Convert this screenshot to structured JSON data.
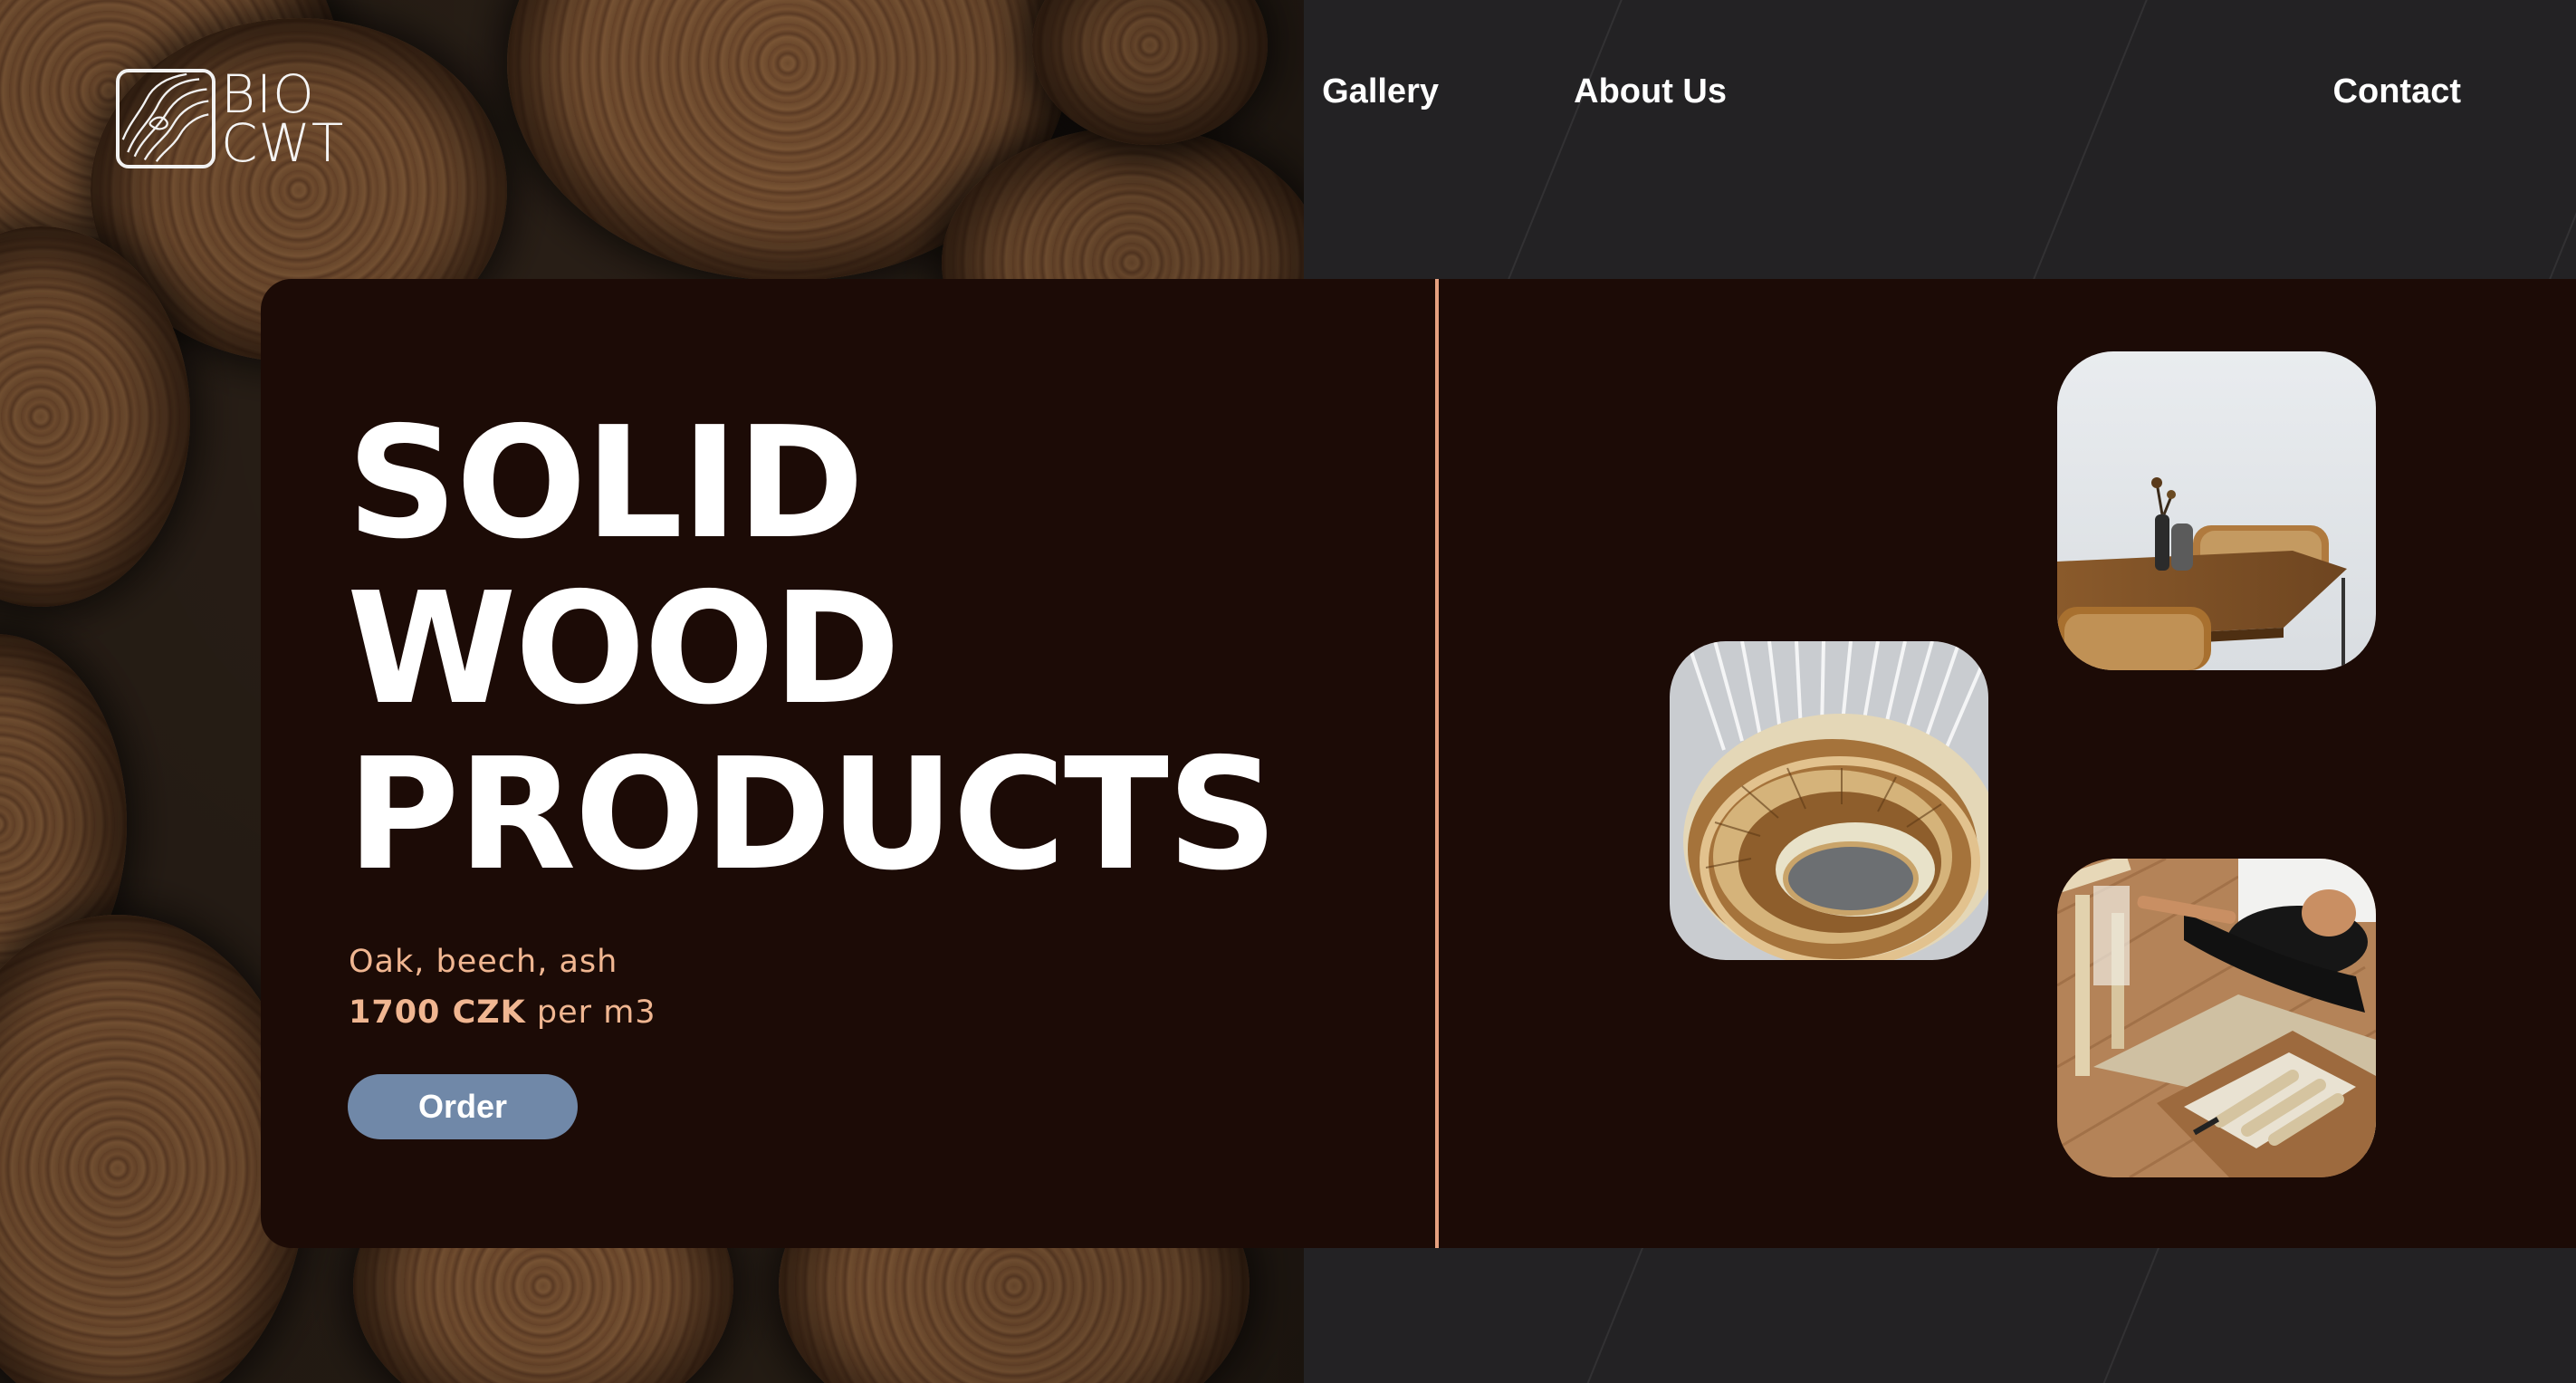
{
  "brand": {
    "logo_line1": "BIO",
    "logo_line2": "CWT",
    "logo_icon": "wood-grain-logo-icon"
  },
  "nav": {
    "items": [
      {
        "label": "Gallery"
      },
      {
        "label": "About Us"
      },
      {
        "label": "Contact"
      }
    ]
  },
  "hero": {
    "headline": [
      "SOLID",
      "WOOD",
      "PRODUCTS"
    ],
    "woods": "Oak, beech, ash",
    "price": "1700 CZK",
    "price_unit": " per m3",
    "cta_label": "Order"
  },
  "gallery": {
    "images": [
      {
        "name": "table-with-chairs-photo"
      },
      {
        "name": "spiral-staircase-photo"
      },
      {
        "name": "assembling-chair-photo"
      }
    ]
  },
  "colors": {
    "page_bg": "#232224",
    "card_bg": "#1c0b06",
    "accent": "#e6a07f",
    "subtext": "#f0b691",
    "button": "#7088a8"
  }
}
